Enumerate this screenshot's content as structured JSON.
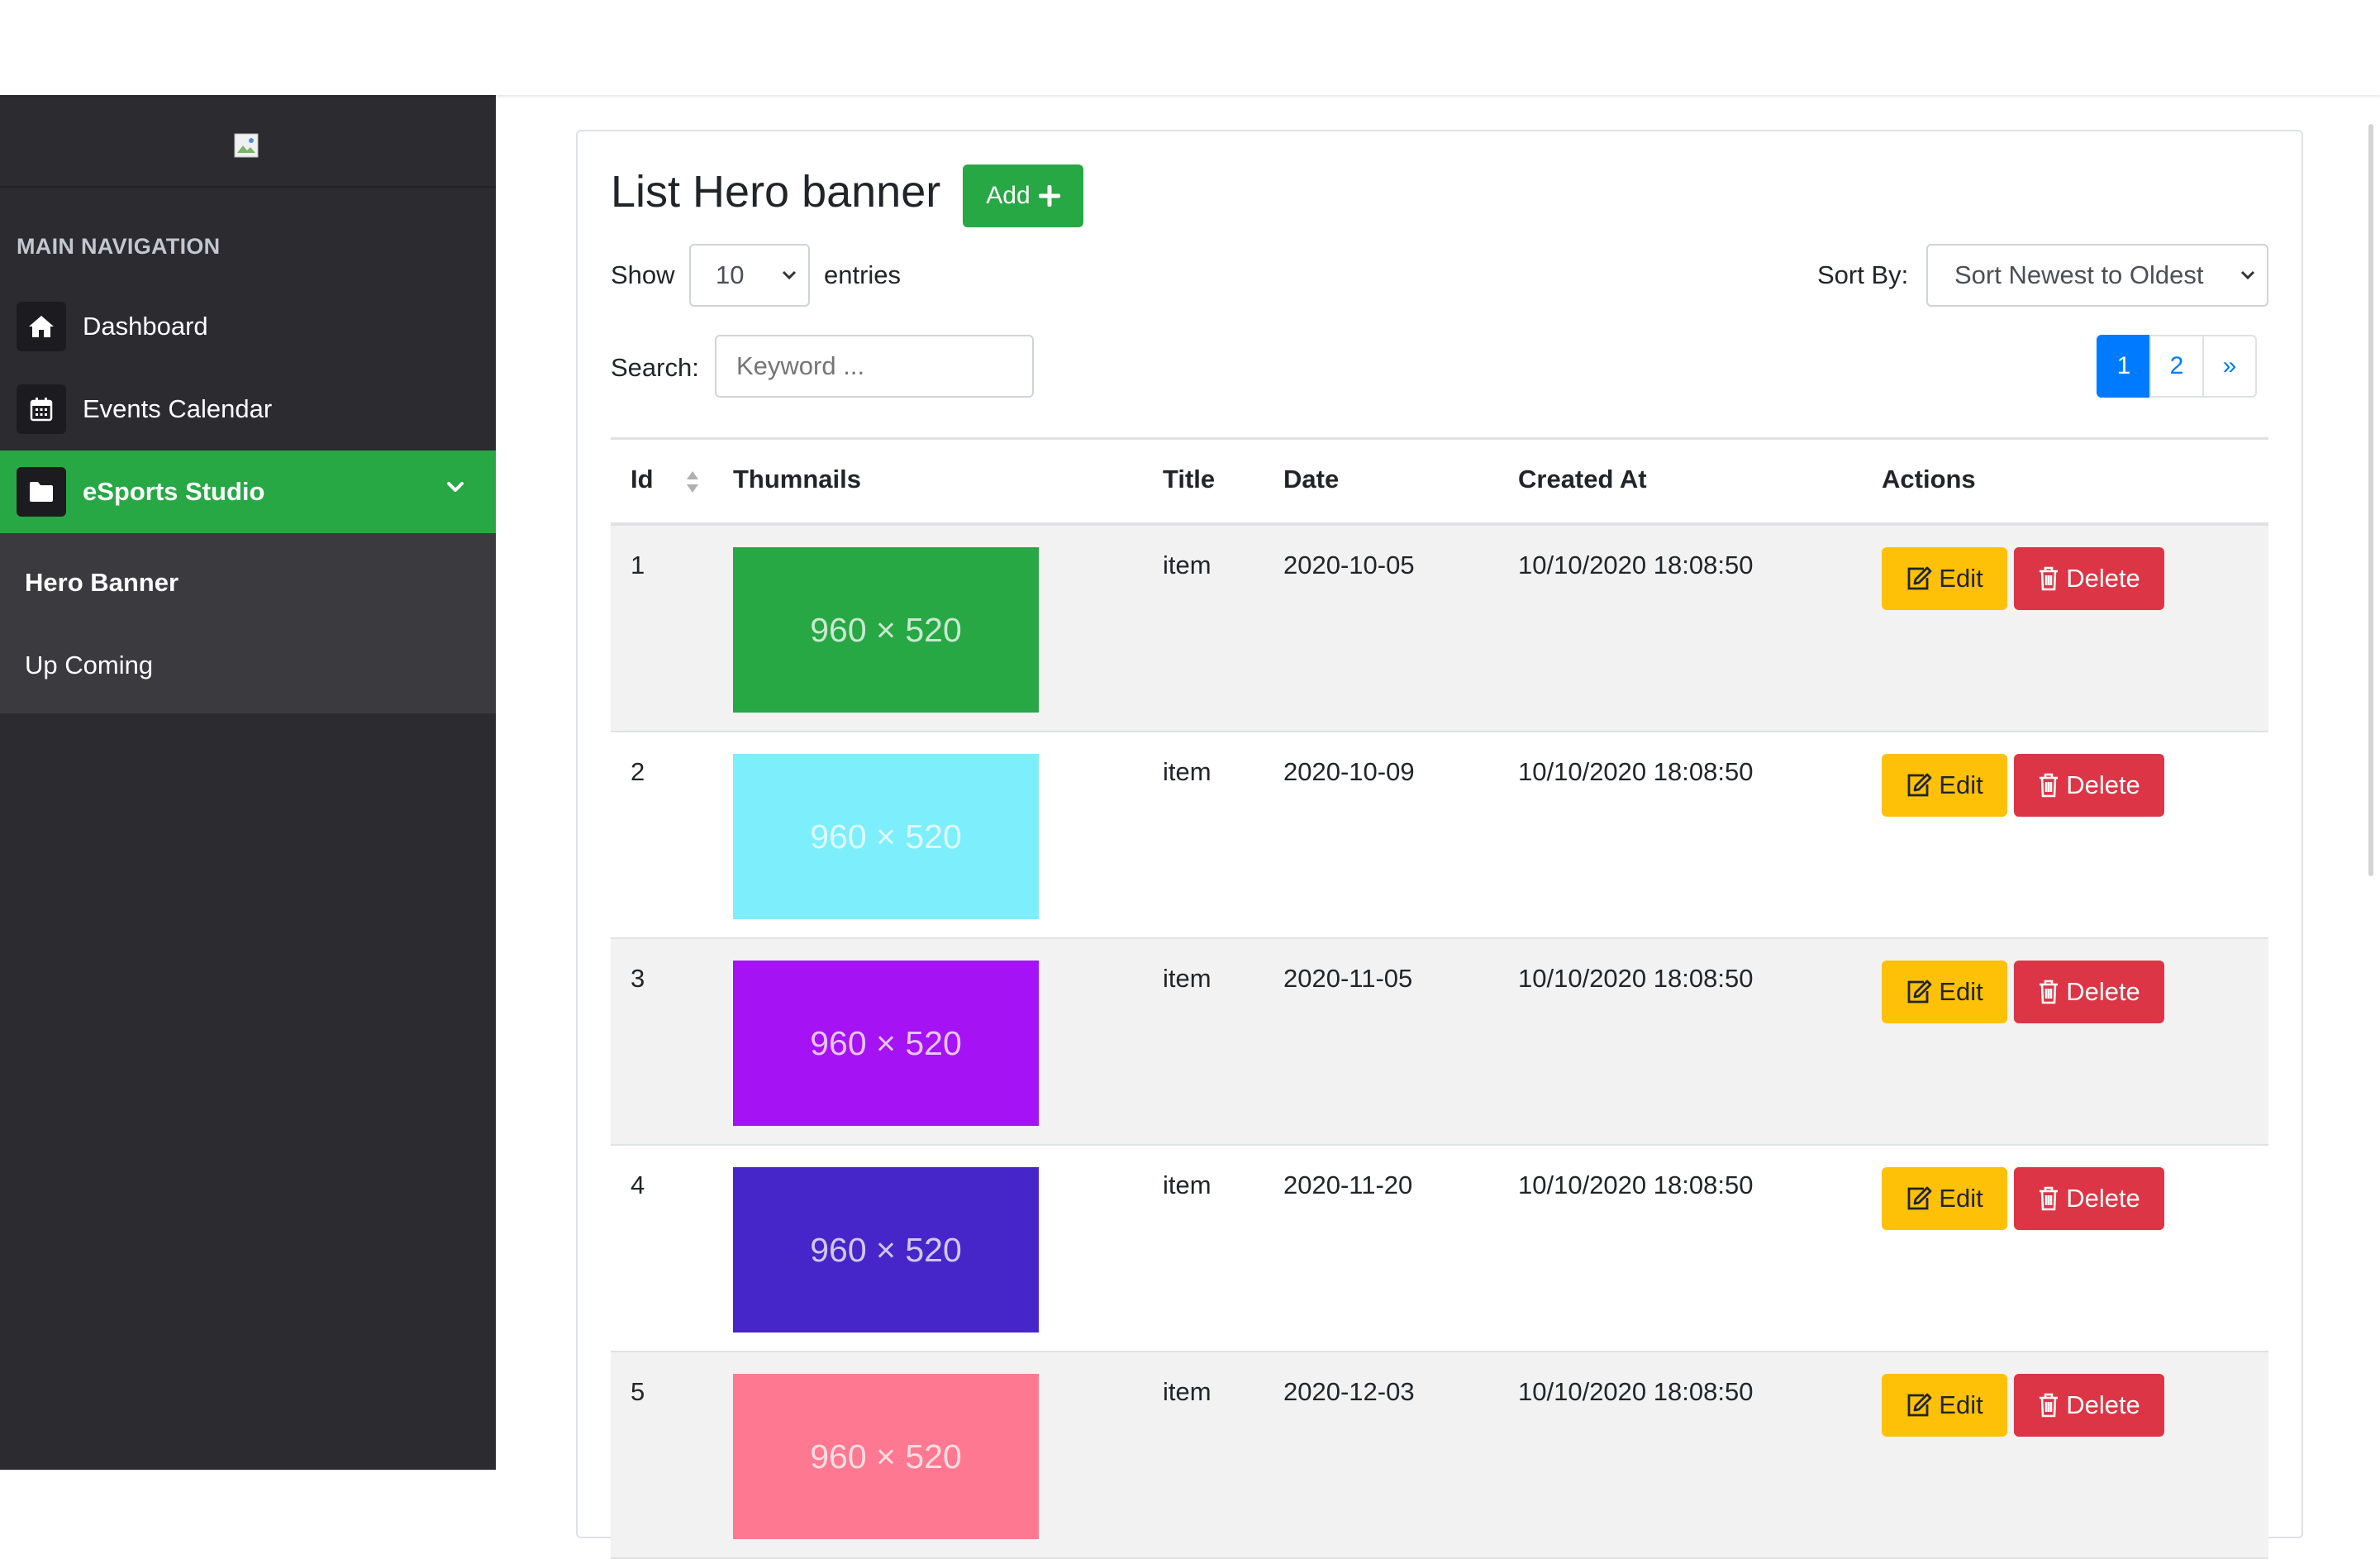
{
  "colors": {
    "sidebar_bg": "#2b2b30",
    "active_green": "#28a745",
    "primary_blue": "#007bff",
    "edit_yellow": "#ffc107",
    "delete_red": "#dc3545"
  },
  "sidebar": {
    "heading": "MAIN NAVIGATION",
    "items": [
      {
        "label": "Dashboard",
        "icon": "home-icon"
      },
      {
        "label": "Events Calendar",
        "icon": "calendar-icon"
      },
      {
        "label": "eSports Studio",
        "icon": "folder-icon",
        "active": true
      }
    ],
    "submenu": [
      {
        "label": "Hero Banner",
        "active": true
      },
      {
        "label": "Up Coming"
      }
    ]
  },
  "page": {
    "title": "List Hero banner",
    "add_label": "Add",
    "show_label": "Show",
    "entries_value": "10",
    "entries_label": "entries",
    "sort_label": "Sort By:",
    "sort_value": "Sort Newest to Oldest",
    "search_label": "Search:",
    "search_placeholder": "Keyword ...",
    "pagination": [
      "1",
      "2",
      "»"
    ],
    "current_page": "1"
  },
  "table": {
    "headers": {
      "id": "Id",
      "thumbnails": "Thumnails",
      "title": "Title",
      "date": "Date",
      "created_at": "Created At",
      "actions": "Actions"
    },
    "edit_label": "Edit",
    "delete_label": "Delete",
    "rows": [
      {
        "id": "1",
        "thumb_text": "960 × 520",
        "thumb_color": "#28a745",
        "title": "item",
        "date": "2020-10-05",
        "created_at": "10/10/2020 18:08:50"
      },
      {
        "id": "2",
        "thumb_text": "960 × 520",
        "thumb_color": "#7deefb",
        "title": "item",
        "date": "2020-10-09",
        "created_at": "10/10/2020 18:08:50"
      },
      {
        "id": "3",
        "thumb_text": "960 × 520",
        "thumb_color": "#a512f3",
        "title": "item",
        "date": "2020-11-05",
        "created_at": "10/10/2020 18:08:50"
      },
      {
        "id": "4",
        "thumb_text": "960 × 520",
        "thumb_color": "#4626c9",
        "title": "item",
        "date": "2020-11-20",
        "created_at": "10/10/2020 18:08:50"
      },
      {
        "id": "5",
        "thumb_text": "960 × 520",
        "thumb_color": "#fd7890",
        "title": "item",
        "date": "2020-12-03",
        "created_at": "10/10/2020 18:08:50"
      }
    ]
  }
}
